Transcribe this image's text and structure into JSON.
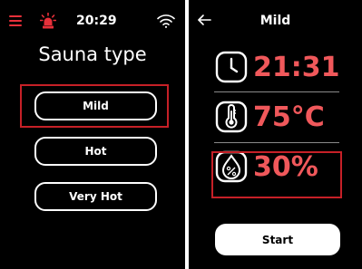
{
  "left_screen": {
    "status_bar": {
      "time": "20:29"
    },
    "title": "Sauna type",
    "options": [
      "Mild",
      "Hot",
      "Very Hot"
    ],
    "selected": "Mild"
  },
  "right_screen": {
    "title": "Mild",
    "time_value": "21:31",
    "temperature_value": "75°C",
    "humidity_value": "30%",
    "start_label": "Start"
  },
  "colors": {
    "accent_red": "#e8303a",
    "value_red": "#f0585b",
    "highlight_red": "#c62027",
    "background": "#000000"
  },
  "icons": [
    "menu-icon",
    "alarm-light-icon",
    "wifi-icon",
    "back-arrow-icon",
    "clock-icon",
    "thermometer-icon",
    "humidity-icon"
  ]
}
